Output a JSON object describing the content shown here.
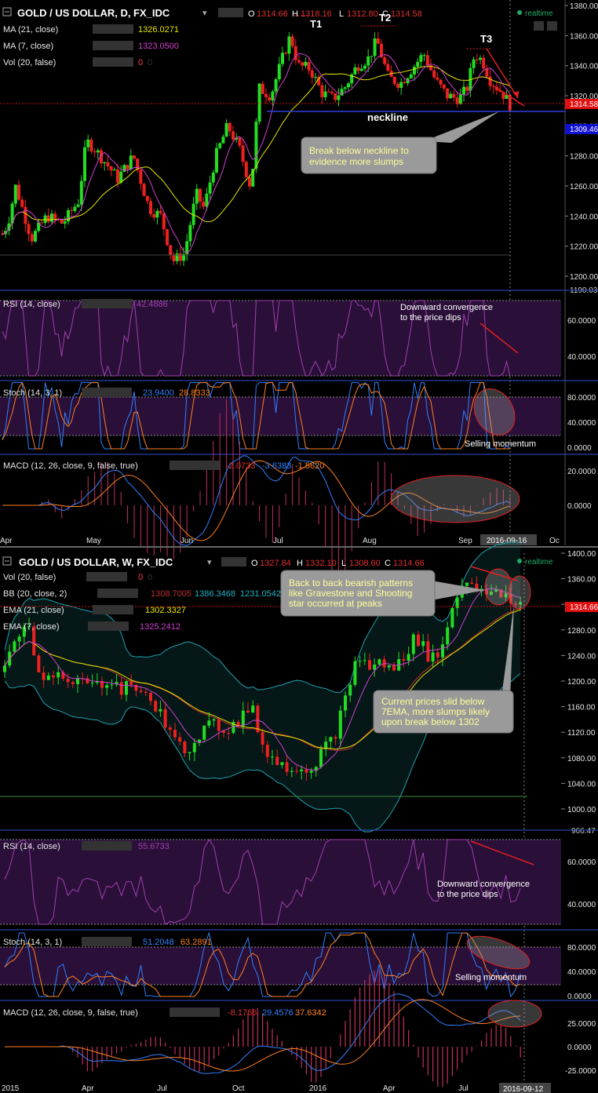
{
  "chart_data": [
    {
      "type": "candlestick",
      "title": "GOLD / US DOLLAR, D, FX_IDC",
      "ohlc": {
        "O": "1314.66",
        "H": "1318.16",
        "L": "1312.80",
        "C": "1314.58"
      },
      "indicators": [
        {
          "name": "MA (21, close)",
          "value": "1326.0271",
          "color": "#e6e600"
        },
        {
          "name": "MA (7, close)",
          "value": "1323.0500",
          "color": "#d040d0"
        },
        {
          "name": "Vol (20, false)",
          "value": "0",
          "extra": "0",
          "color": "#ff4040"
        }
      ],
      "realtime": "realtime",
      "price_labels": {
        "last": "1314.58",
        "neckline": "1309.46",
        "bottom": "1190.03"
      },
      "y_ticks": [
        "1380.00",
        "1360.00",
        "1340.00",
        "1320.00",
        "1300.00",
        "1280.00",
        "1260.00",
        "1240.00",
        "1220.00",
        "1200.00"
      ],
      "x_ticks": [
        "Apr",
        "May",
        "Jun",
        "Jul",
        "Aug",
        "Sep",
        "Oc"
      ],
      "date_marker": "2016-09-16",
      "annotations": {
        "t1": "T1",
        "t2": "T2",
        "t3": "T3",
        "neckline": "neckline",
        "callout": [
          "Break below neckline to",
          "evidence more slumps"
        ]
      },
      "close_path": [
        [
          0,
          1225
        ],
        [
          10,
          1235
        ],
        [
          20,
          1260
        ],
        [
          40,
          1225
        ],
        [
          60,
          1240
        ],
        [
          80,
          1235
        ],
        [
          100,
          1250
        ],
        [
          110,
          1290
        ],
        [
          120,
          1285
        ],
        [
          135,
          1275
        ],
        [
          150,
          1265
        ],
        [
          170,
          1280
        ],
        [
          190,
          1245
        ],
        [
          205,
          1240
        ],
        [
          220,
          1210
        ],
        [
          235,
          1215
        ],
        [
          250,
          1255
        ],
        [
          260,
          1245
        ],
        [
          275,
          1280
        ],
        [
          290,
          1300
        ],
        [
          305,
          1285
        ],
        [
          320,
          1258
        ],
        [
          330,
          1325
        ],
        [
          345,
          1320
        ],
        [
          360,
          1345
        ],
        [
          370,
          1360
        ],
        [
          380,
          1340
        ],
        [
          395,
          1338
        ],
        [
          410,
          1322
        ],
        [
          425,
          1318
        ],
        [
          440,
          1326
        ],
        [
          455,
          1340
        ],
        [
          470,
          1345
        ],
        [
          480,
          1357
        ],
        [
          495,
          1332
        ],
        [
          510,
          1328
        ],
        [
          525,
          1338
        ],
        [
          540,
          1348
        ],
        [
          555,
          1330
        ],
        [
          570,
          1320
        ],
        [
          585,
          1318
        ],
        [
          595,
          1325
        ],
        [
          605,
          1348
        ],
        [
          615,
          1343
        ],
        [
          625,
          1330
        ],
        [
          640,
          1322
        ],
        [
          650,
          1314
        ]
      ]
    },
    {
      "type": "line",
      "title": "RSI (14, close)",
      "value": "42.4886",
      "y_ticks": [
        "60.0000",
        "40.0000"
      ],
      "annotation": [
        "Downward convergence",
        "to the price dips"
      ]
    },
    {
      "type": "line",
      "title": "Stoch (14, 3, 1)",
      "values": [
        "23.9400",
        "28.8333"
      ],
      "y_ticks": [
        "80.0000",
        "40.0000",
        "0.0000"
      ],
      "annotation": "Selling momentum"
    },
    {
      "type": "bar",
      "title": "MACD (12, 26, close, 9, false, true)",
      "values": [
        "-2.0733",
        "-3.6383",
        "-1.5620"
      ],
      "y_ticks": [
        "20.0000",
        "0.0000"
      ]
    },
    {
      "type": "candlestick",
      "title": "GOLD / US DOLLAR, W, FX_IDC",
      "ohlc": {
        "O": "1327.84",
        "H": "1332.10",
        "L": "1308.60",
        "C": "1314.66"
      },
      "indicators": [
        {
          "name": "Vol (20, false)",
          "value": "0",
          "extra": "0",
          "color": "#ff4040"
        },
        {
          "name": "BB (20, close, 2)",
          "value": "1308.7005",
          "extra": "1386.3468",
          "extra2": "1231.0542",
          "color": "#20b0c0"
        },
        {
          "name": "EMA (21, close)",
          "value": "1302.3327",
          "color": "#e6e600"
        },
        {
          "name": "EMA (7, close)",
          "value": "1325.2412",
          "color": "#d040d0"
        }
      ],
      "realtime": "realtime",
      "price_labels": {
        "last": "1314.66",
        "bottom": "966.47"
      },
      "y_ticks": [
        "1400.00",
        "1360.00",
        "1320.00",
        "1280.00",
        "1240.00",
        "1200.00",
        "1160.00",
        "1120.00",
        "1080.00",
        "1040.00",
        "1000.00"
      ],
      "x_ticks": [
        "2015",
        "Apr",
        "Jul",
        "Oct",
        "2016",
        "Apr",
        "Jul"
      ],
      "date_marker": "2016-09-12",
      "callouts": [
        [
          "Back to back bearish patterns",
          "like Gravestone and Shooting",
          "star occurred at peaks"
        ],
        [
          "Current prices slid below",
          "7EMA, more slumps likely",
          "upon break below 1302"
        ]
      ],
      "close_path": [
        [
          5,
          1210
        ],
        [
          20,
          1270
        ],
        [
          35,
          1290
        ],
        [
          45,
          1225
        ],
        [
          60,
          1205
        ],
        [
          75,
          1220
        ],
        [
          90,
          1190
        ],
        [
          105,
          1200
        ],
        [
          120,
          1190
        ],
        [
          140,
          1205
        ],
        [
          155,
          1185
        ],
        [
          170,
          1195
        ],
        [
          185,
          1175
        ],
        [
          200,
          1160
        ],
        [
          215,
          1120
        ],
        [
          225,
          1100
        ],
        [
          240,
          1095
        ],
        [
          255,
          1120
        ],
        [
          270,
          1130
        ],
        [
          290,
          1125
        ],
        [
          305,
          1140
        ],
        [
          320,
          1160
        ],
        [
          335,
          1100
        ],
        [
          350,
          1075
        ],
        [
          365,
          1065
        ],
        [
          380,
          1070
        ],
        [
          395,
          1060
        ],
        [
          410,
          1090
        ],
        [
          425,
          1110
        ],
        [
          440,
          1170
        ],
        [
          455,
          1240
        ],
        [
          470,
          1220
        ],
        [
          485,
          1230
        ],
        [
          500,
          1215
        ],
        [
          515,
          1240
        ],
        [
          530,
          1270
        ],
        [
          545,
          1240
        ],
        [
          560,
          1240
        ],
        [
          575,
          1310
        ],
        [
          590,
          1360
        ],
        [
          600,
          1345
        ],
        [
          615,
          1335
        ],
        [
          630,
          1340
        ],
        [
          645,
          1335
        ],
        [
          660,
          1316
        ]
      ]
    },
    {
      "type": "line",
      "title": "RSI (14, close)",
      "value": "55.6733",
      "y_ticks": [
        "60.0000",
        "40.0000"
      ],
      "annotation": [
        "Downward convergence",
        "to the price dips"
      ]
    },
    {
      "type": "line",
      "title": "Stoch (14, 3, 1)",
      "values": [
        "51.2048",
        "63.2891"
      ],
      "y_ticks": [
        "80.0000",
        "40.0000",
        "0.0000"
      ],
      "annotation": "Selling momentum"
    },
    {
      "type": "bar",
      "title": "MACD (12, 26, close, 9, false, true)",
      "values": [
        "-8.1766",
        "29.4576",
        "37.6342"
      ],
      "y_ticks": [
        "25.0000",
        "0.0000",
        "-25.0000"
      ]
    }
  ],
  "colors": {
    "bull": "#22dd22",
    "bear": "#ee2020",
    "ma_fast": "#d040d0",
    "ma_slow": "#e6e600",
    "bb": "#20b0c0",
    "label_red": "#e01010",
    "label_blue": "#1010d0",
    "panel_purple": "#2a0f38"
  }
}
